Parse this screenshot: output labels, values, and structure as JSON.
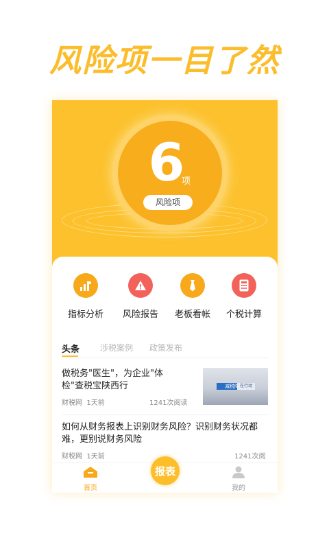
{
  "headline": "风险项一目了然",
  "risk": {
    "count": "6",
    "unit": "项",
    "button_label": "风险项"
  },
  "tools": [
    {
      "label": "指标分析",
      "icon": "bar-chart-icon",
      "color": "#f7a81b"
    },
    {
      "label": "风险报告",
      "icon": "warning-icon",
      "color": "#f2625b"
    },
    {
      "label": "老板看帐",
      "icon": "tie-icon",
      "color": "#f7a81b"
    },
    {
      "label": "个税计算",
      "icon": "calculator-icon",
      "color": "#f2625b"
    }
  ],
  "news_tabs": [
    {
      "label": "头条",
      "active": true
    },
    {
      "label": "涉税案例",
      "active": false
    },
    {
      "label": "政策发布",
      "active": false
    }
  ],
  "news": [
    {
      "title": "做税务\"医生\"，为企业\"体检\"查税宝陕西行",
      "source": "财税网",
      "time": "1天前",
      "reads": "1241次阅读",
      "thumb_text": "减税降费",
      "thumb_text2": "在行动"
    },
    {
      "title": "如何从财务报表上识别财务风险？识别财务状况都难，更别说财务风险",
      "source": "财税网",
      "time": "1天前",
      "reads": "1241次阅读"
    }
  ],
  "tabbar": {
    "home": "首页",
    "center": "报表",
    "mine": "我的"
  },
  "colors": {
    "brand": "#fcc12d",
    "accent": "#f7a81b",
    "red": "#f2625b"
  }
}
